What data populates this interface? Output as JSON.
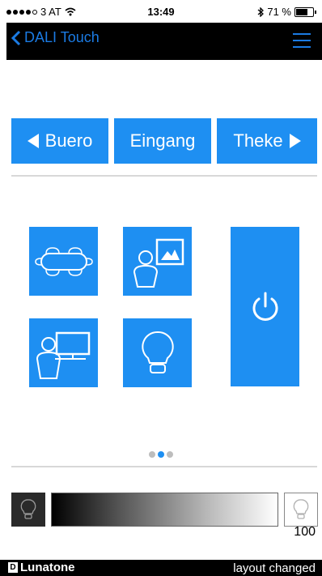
{
  "status_bar": {
    "carrier": "3 AT",
    "time": "13:49",
    "battery": "71 %",
    "battery_level": 0.71,
    "signal_bars": 4,
    "signal_max": 5
  },
  "nav": {
    "back_label": "DALI Touch",
    "menu_icon": "hamburger-menu-icon"
  },
  "rooms": {
    "prev_label": "Buero",
    "current_label": "Eingang",
    "next_label": "Theke"
  },
  "scenes": [
    {
      "name": "meeting-table",
      "icon": "conference-table-icon"
    },
    {
      "name": "presentation",
      "icon": "person-with-picture-icon"
    },
    {
      "name": "screen",
      "icon": "person-with-screen-icon"
    },
    {
      "name": "light",
      "icon": "light-bulb-icon"
    },
    {
      "name": "power",
      "icon": "power-icon"
    }
  ],
  "pager": {
    "count": 3,
    "active_index": 1
  },
  "dimmer": {
    "value": "100",
    "level": 1.0
  },
  "footer": {
    "brand": "Lunatone",
    "brand_mark": "D",
    "status_text": "layout changed"
  },
  "colors": {
    "accent": "#1e8ff2",
    "nav_text": "#1b7be3",
    "nav_bg": "#000000"
  }
}
